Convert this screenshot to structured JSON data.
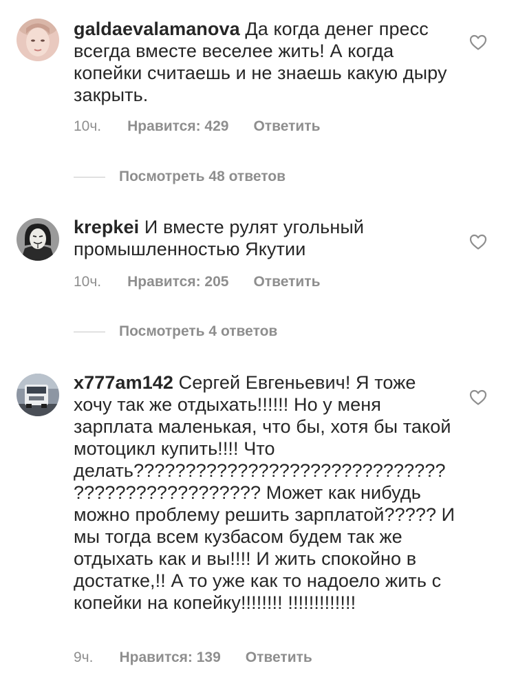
{
  "comments": [
    {
      "username": "galdaevalamanova",
      "text": " Да когда денег пресс всегда вместе веселее жить! А когда копейки считаешь и не знаешь какую дыру закрыть.",
      "time": "10ч.",
      "likes": "Нравится: 429",
      "reply": "Ответить",
      "view_replies": "Посмотреть 48 ответов",
      "avatar_icon": "woman-portrait-icon"
    },
    {
      "username": "krepkei",
      "text": " И вместе рулят угольный промышленностью Якутии",
      "time": "10ч.",
      "likes": "Нравится: 205",
      "reply": "Ответить",
      "view_replies": "Посмотреть 4 ответов",
      "avatar_icon": "mask-portrait-icon"
    },
    {
      "username": "x777am142",
      "text": " Сергей Евгеньевич! Я тоже хочу так же отдыхать!!!!!! Но у меня зарплата маленькая, что бы, хотя бы такой мотоцикл купить!!!! Что делать?????????????????????????????? ?????????????????? Может как нибудь можно проблему решить зарплатой????? И мы тогда всем кузбасом будем так же отдыхать как и вы!!!! И жить спокойно в достатке,!! А то уже как то надоело жить с копейки на копейку!!!!!!!! !!!!!!!!!!!!!",
      "time": "9ч.",
      "likes": "Нравится: 139",
      "reply": "Ответить",
      "avatar_icon": "truck-photo-icon"
    }
  ],
  "colors": {
    "text": "#262626",
    "secondary": "#8e8e8e",
    "divider": "#c7c7c7"
  }
}
